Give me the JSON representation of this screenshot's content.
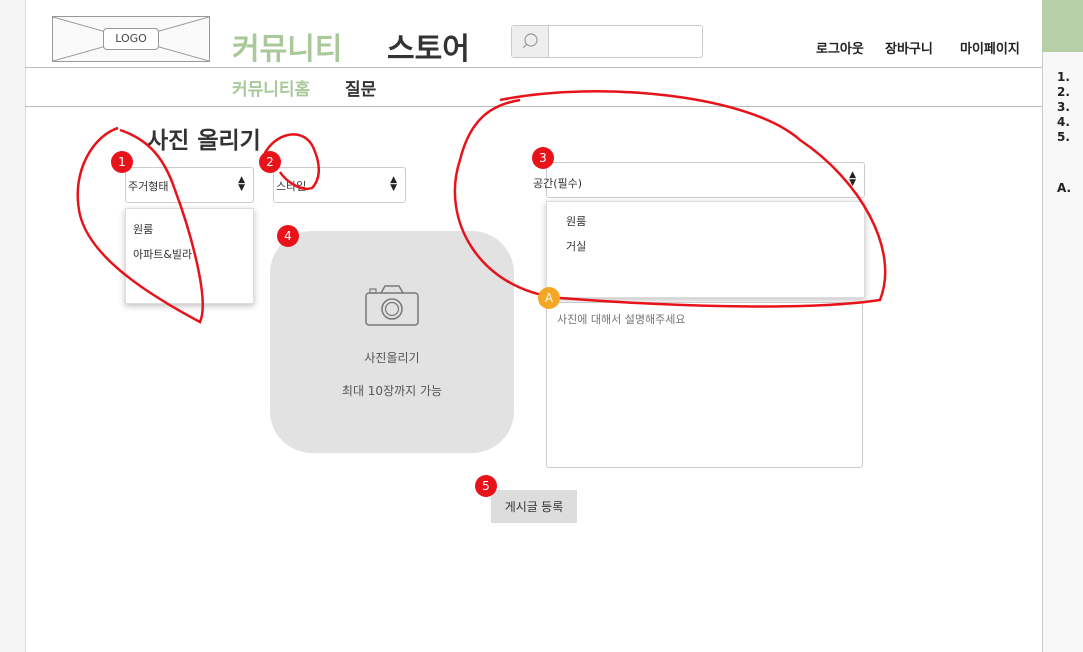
{
  "logo": {
    "label": "LOGO"
  },
  "nav": {
    "community": "커뮤니티",
    "store": "스토어"
  },
  "search": {
    "placeholder": ""
  },
  "top_links": {
    "logout": "로그아웃",
    "cart": "장바구니",
    "mypage": "마이페이지"
  },
  "subnav": {
    "home": "커뮤니티홈",
    "question": "질문"
  },
  "page_title": "사진 올리기",
  "housing_select": {
    "value": "주거형태",
    "options": [
      "원룸",
      "아파트&빌라"
    ]
  },
  "style_select": {
    "value": "스타일"
  },
  "space_select": {
    "value": "공간(필수)",
    "options": [
      "원룸",
      "거실"
    ]
  },
  "upload": {
    "title": "사진올리기",
    "limit": "최대 10장까지 가능"
  },
  "description": {
    "placeholder": "사진에 대해서 설명해주세요"
  },
  "submit_label": "게시글 등록",
  "annotations": {
    "n1": "1",
    "n2": "2",
    "n3": "3",
    "n4": "4",
    "n5": "5",
    "a": "A"
  },
  "right_panel": {
    "items": [
      "1.",
      "2.",
      "3.",
      "4.",
      "5."
    ],
    "note": "A."
  },
  "colors": {
    "accent_green": "#a9c99a",
    "panel_header": "#b6cfa6",
    "marker_red": "#e8131a",
    "marker_orange": "#f5a623"
  }
}
